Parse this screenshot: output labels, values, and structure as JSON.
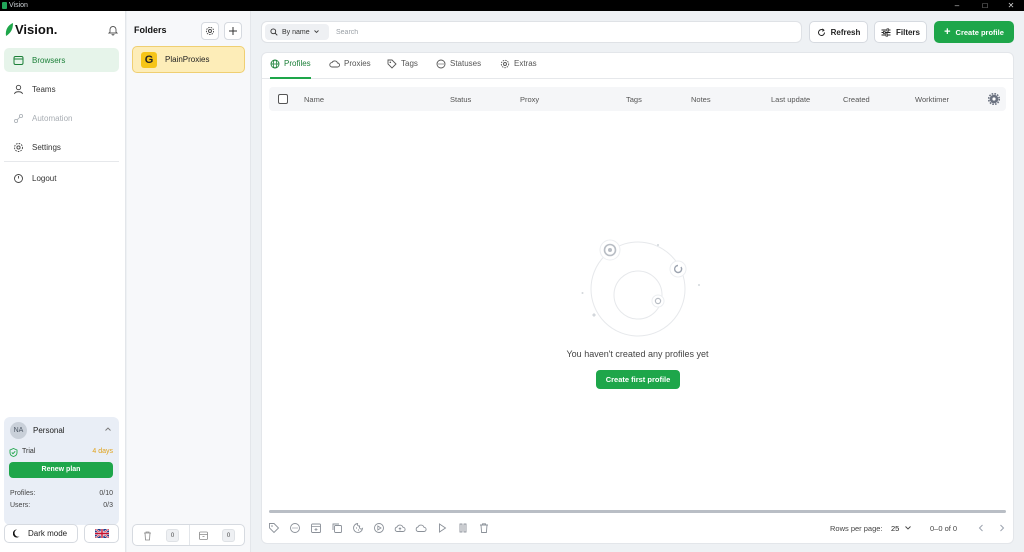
{
  "window": {
    "title": "Vision"
  },
  "brand": {
    "name": "Vision.",
    "accent": "#1ea64a"
  },
  "sidebar": {
    "items": [
      {
        "label": "Browsers",
        "icon": "browsers-icon"
      },
      {
        "label": "Teams",
        "icon": "user-icon"
      },
      {
        "label": "Automation",
        "icon": "automation-icon"
      },
      {
        "label": "Settings",
        "icon": "gear-icon"
      },
      {
        "label": "Logout",
        "icon": "power-icon"
      }
    ]
  },
  "account": {
    "initials": "NA",
    "name": "Personal",
    "plan_label": "Trial",
    "plan_days": "4 days",
    "renew_label": "Renew plan",
    "profiles_label": "Profiles:",
    "profiles_value": "0/10",
    "users_label": "Users:",
    "users_value": "0/3"
  },
  "footer": {
    "dark_mode_label": "Dark mode",
    "language_flag": "uk-flag-icon"
  },
  "folders": {
    "title": "Folders",
    "items": [
      {
        "label": "PlainProxies",
        "letter": "G"
      }
    ],
    "trash_count": "0",
    "archive_count": "0"
  },
  "toolbar": {
    "sort_label": "By name",
    "search_placeholder": "Search",
    "refresh_label": "Refresh",
    "filters_label": "Filters",
    "create_label": "Create profile"
  },
  "tabs": [
    {
      "label": "Profiles",
      "icon": "globe-icon"
    },
    {
      "label": "Proxies",
      "icon": "cloud-icon"
    },
    {
      "label": "Tags",
      "icon": "tag-icon"
    },
    {
      "label": "Statuses",
      "icon": "status-icon"
    },
    {
      "label": "Extras",
      "icon": "gear-icon"
    }
  ],
  "table": {
    "columns": [
      "Name",
      "Status",
      "Proxy",
      "Tags",
      "Notes",
      "Last update",
      "Created",
      "Worktimer"
    ]
  },
  "empty_state": {
    "message": "You haven't created any profiles yet",
    "button_label": "Create first profile"
  },
  "pagination": {
    "rows_per_page_label": "Rows per page:",
    "rows_per_page_value": "25",
    "range_label": "0–0 of 0"
  }
}
